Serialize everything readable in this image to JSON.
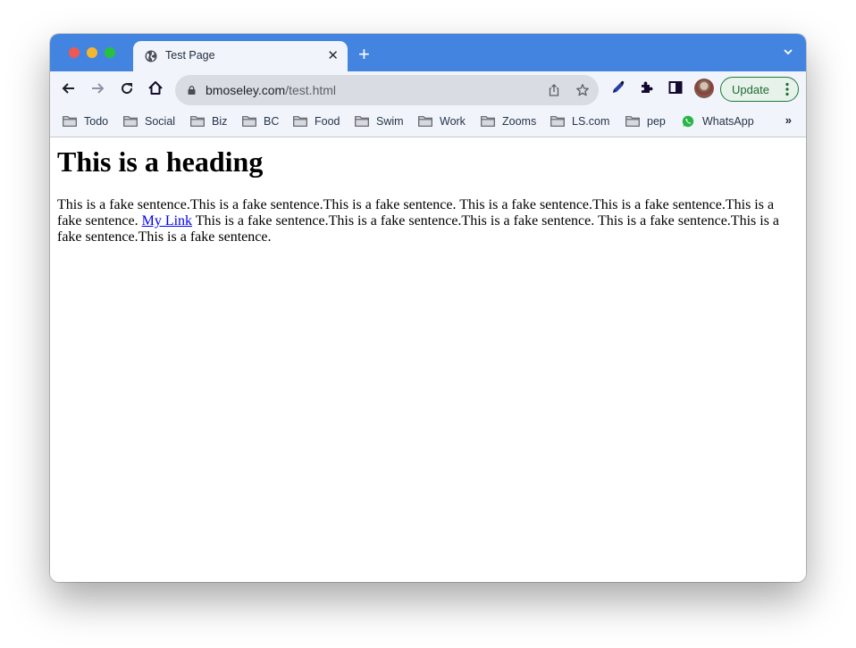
{
  "window": {
    "controls": [
      "close",
      "minimize",
      "maximize"
    ]
  },
  "tab": {
    "icon": "globe-icon",
    "title": "Test Page",
    "close_label": "✕"
  },
  "new_tab_label": "+",
  "toolbar": {
    "back_icon": "arrow-left-icon",
    "forward_icon": "arrow-right-icon",
    "reload_icon": "reload-icon",
    "home_icon": "home-icon",
    "url_domain": "bmoseley.com",
    "url_path": "/test.html",
    "share_icon": "share-icon",
    "bookmark_icon": "star-icon",
    "extension_icons": [
      "eyedropper-icon",
      "puzzle-icon",
      "side-panel-icon"
    ],
    "update_label": "Update"
  },
  "bookmarks": {
    "items": [
      {
        "label": "Todo",
        "icon": "folder-icon"
      },
      {
        "label": "Social",
        "icon": "folder-icon"
      },
      {
        "label": "Biz",
        "icon": "folder-icon"
      },
      {
        "label": "BC",
        "icon": "folder-icon"
      },
      {
        "label": "Food",
        "icon": "folder-icon"
      },
      {
        "label": "Swim",
        "icon": "folder-icon"
      },
      {
        "label": "Work",
        "icon": "folder-icon"
      },
      {
        "label": "Zooms",
        "icon": "folder-icon"
      },
      {
        "label": "LS.com",
        "icon": "folder-icon"
      },
      {
        "label": "pep",
        "icon": "folder-icon"
      },
      {
        "label": "WhatsApp",
        "icon": "whatsapp-icon"
      }
    ],
    "more_label": "»"
  },
  "page": {
    "heading": "This is a heading",
    "text_before_link": "This is a fake sentence.This is a fake sentence.This is a fake sentence. This is a fake sentence.This is a fake sentence.This is a fake sentence. ",
    "link_text": "My Link",
    "text_after_link": " This is a fake sentence.This is a fake sentence.This is a fake sentence. This is a fake sentence.This is a fake sentence.This is a fake sentence."
  },
  "colors": {
    "titlebar": "#4384e0",
    "toolbar": "#f1f5fb",
    "link": "#0000ee",
    "update_border": "#1e7a3b"
  }
}
